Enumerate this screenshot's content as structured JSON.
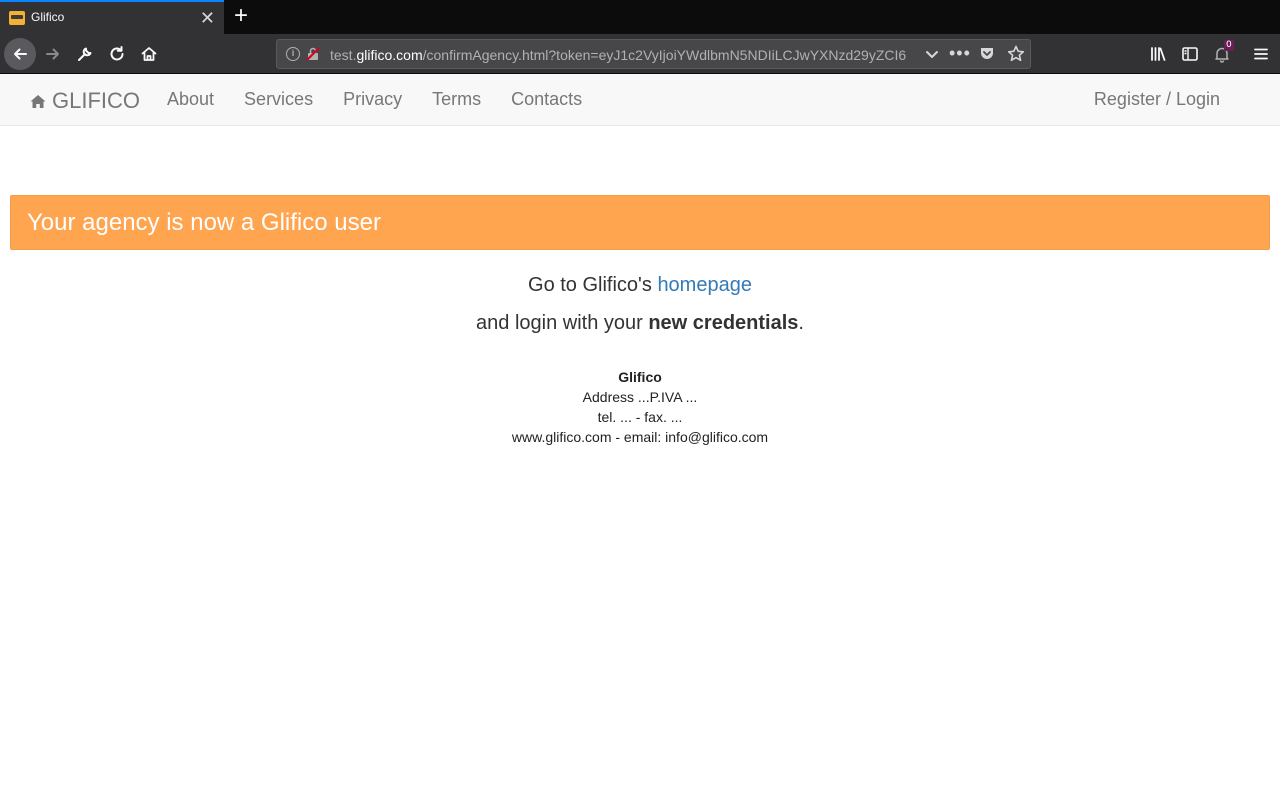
{
  "browser": {
    "tab": {
      "title": "Glifico",
      "close_glyph": "✕",
      "favicon": "glifico-favicon"
    },
    "new_tab_glyph": "+",
    "url": {
      "prefix": "test.",
      "host": "glifico.com",
      "path": "/confirmAgency.html?token=eyJ1c2VyIjoiYWdlbmN5NDIiLCJwYXNzd29yZCI6"
    },
    "more_glyph": "•••",
    "notification_count": "0",
    "colors": {
      "chrome_dark": "#0c0c0d",
      "chrome": "#323234",
      "urlbar": "#474749",
      "tab_accent": "#0a84ff",
      "notification_badge": "#6b1f5a"
    }
  },
  "site_nav": {
    "brand": "GLIFICO",
    "brand_icon": "home-icon",
    "links": [
      "About",
      "Services",
      "Privacy",
      "Terms",
      "Contacts"
    ],
    "login": "Register / Login"
  },
  "alert": {
    "text": "Your agency is now a Glifico user",
    "color": "#ffa550"
  },
  "message": {
    "line1_prefix": "Go to Glifico's ",
    "line1_link": "homepage",
    "line2_prefix": "and login with your ",
    "line2_bold": "new credentials",
    "line2_suffix": "."
  },
  "footer": {
    "company": "Glifico",
    "address": "Address ...P.IVA ...",
    "phone": "tel. ... - fax. ...",
    "contact": "www.glifico.com - email: info@glifico.com"
  }
}
